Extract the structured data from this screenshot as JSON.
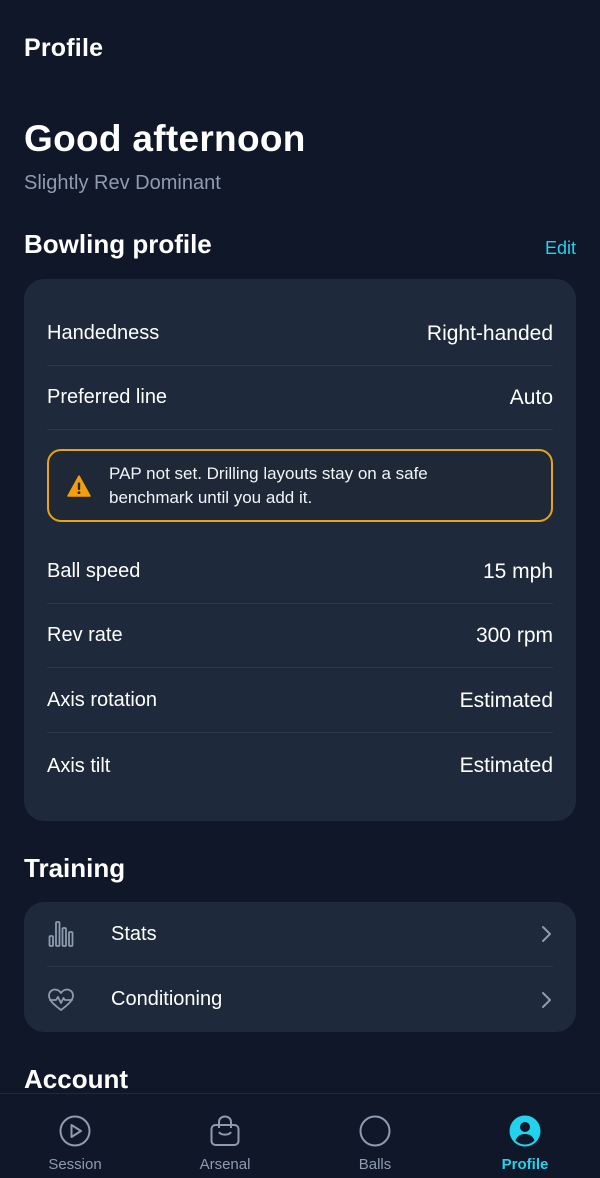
{
  "header": {
    "title": "Profile"
  },
  "greeting": {
    "title": "Good afternoon",
    "subtitle": "Slightly Rev Dominant"
  },
  "bowling_profile": {
    "title": "Bowling profile",
    "edit_label": "Edit",
    "rows_top": [
      {
        "label": "Handedness",
        "value": "Right-handed"
      },
      {
        "label": "Preferred line",
        "value": "Auto"
      }
    ],
    "warning": {
      "icon": "warning-triangle-icon",
      "text": "PAP not set. Drilling layouts stay on a safe benchmark until you add it."
    },
    "rows_bottom": [
      {
        "label": "Ball speed",
        "value": "15 mph"
      },
      {
        "label": "Rev rate",
        "value": "300 rpm"
      },
      {
        "label": "Axis rotation",
        "value": "Estimated"
      },
      {
        "label": "Axis tilt",
        "value": "Estimated"
      }
    ]
  },
  "training": {
    "title": "Training",
    "items": [
      {
        "label": "Stats",
        "icon": "bar-chart-icon"
      },
      {
        "label": "Conditioning",
        "icon": "heart-pulse-icon"
      }
    ]
  },
  "account": {
    "title": "Account"
  },
  "tabbar": {
    "tabs": [
      {
        "label": "Session",
        "icon": "play-circle-icon",
        "active": false
      },
      {
        "label": "Arsenal",
        "icon": "bag-icon",
        "active": false
      },
      {
        "label": "Balls",
        "icon": "circle-icon",
        "active": false
      },
      {
        "label": "Profile",
        "icon": "user-circle-icon",
        "active": true
      }
    ]
  },
  "colors": {
    "background": "#0f1729",
    "card": "#1e293b",
    "accent": "#22d3ee",
    "warning": "#e8a317",
    "muted": "#8e9bb0"
  }
}
